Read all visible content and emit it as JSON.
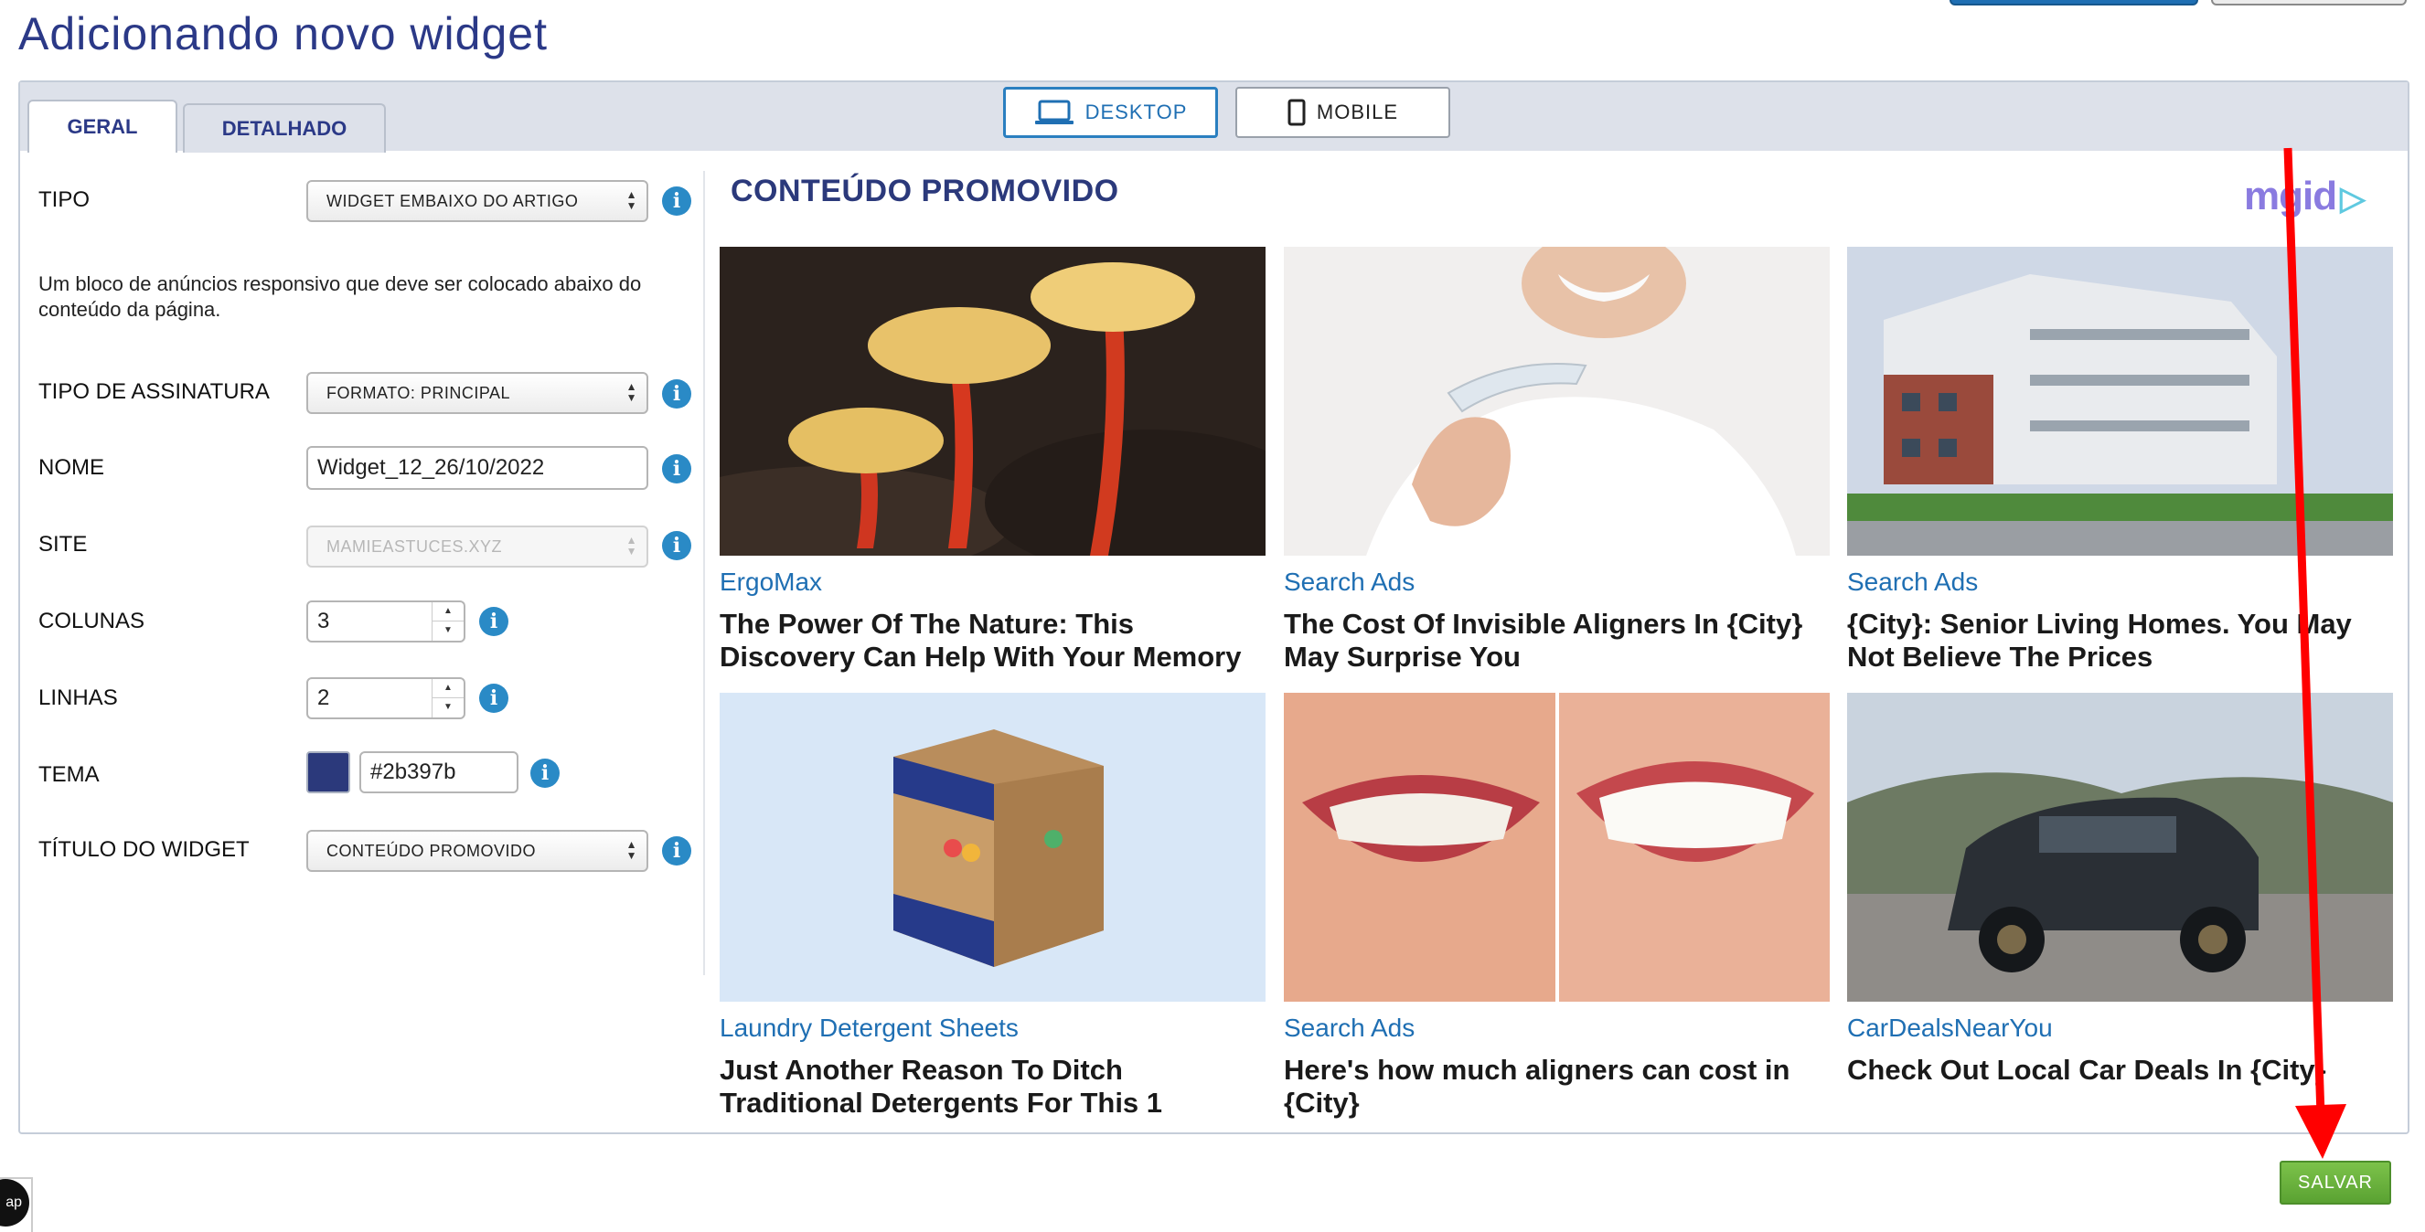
{
  "page": {
    "title": "Adicionando novo widget"
  },
  "tabs": [
    {
      "label": "GERAL"
    },
    {
      "label": "DETALHADO"
    }
  ],
  "view": {
    "desktop": "DESKTOP",
    "mobile": "MOBILE"
  },
  "form": {
    "tipo_label": "TIPO",
    "tipo_value": "WIDGET EMBAIXO DO ARTIGO",
    "description": "Um bloco de anúncios responsivo que deve ser colocado abaixo do conteúdo da página.",
    "assinatura_label": "TIPO DE ASSINATURA",
    "assinatura_value": "FORMATO: PRINCIPAL",
    "nome_label": "NOME",
    "nome_value": "Widget_12_26/10/2022",
    "site_label": "SITE",
    "site_value": "MAMIEASTUCES.XYZ",
    "colunas_label": "COLUNAS",
    "colunas_value": "3",
    "linhas_label": "LINHAS",
    "linhas_value": "2",
    "tema_label": "TEMA",
    "tema_value": "#2b397b",
    "titulo_label": "TÍTULO DO WIDGET",
    "titulo_value": "CONTEÚDO PROMOVIDO"
  },
  "preview": {
    "title": "CONTEÚDO PROMOVIDO",
    "logo": "mgid",
    "cards": [
      {
        "source": "ErgoMax",
        "title": "The Power Of The Nature: This Discovery Can Help With Your Memory"
      },
      {
        "source": "Search Ads",
        "title": "The Cost Of Invisible Aligners In {City} May Surprise You"
      },
      {
        "source": "Search Ads",
        "title": "{City}: Senior Living Homes. You May Not Believe The Prices"
      },
      {
        "source": "Laundry Detergent Sheets",
        "title": "Just Another Reason To Ditch Traditional Detergents For This 1"
      },
      {
        "source": "Search Ads",
        "title": "Here's how much aligners can cost in {City}"
      },
      {
        "source": "CarDealsNearYou",
        "title": "Check Out Local Car Deals In {City}"
      }
    ]
  },
  "actions": {
    "save": "SALVAR"
  },
  "colors": {
    "accent": "#2b397b",
    "link": "#1f6fb3",
    "save": "#5aa232",
    "annotation_arrow": "#ff0000"
  }
}
